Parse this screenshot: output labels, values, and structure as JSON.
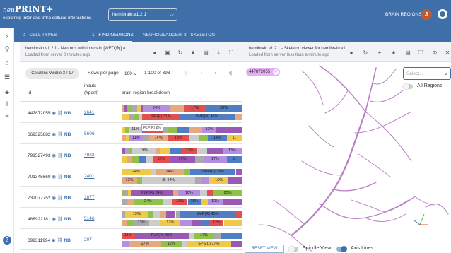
{
  "app": {
    "brand_prefix": "neu",
    "brand_main": "PRINT+",
    "subtitle": "exploring inter and intra cellular interactions",
    "dataset": "hemibrain:v1.2.1",
    "brain_regions_link": "BRAIN REGIONS",
    "user_initial": "J"
  },
  "sidebar": {
    "items": [
      {
        "icon": "chevron-right-icon",
        "glyph": "›"
      },
      {
        "icon": "search-icon",
        "glyph": "⚲"
      },
      {
        "icon": "home-icon",
        "glyph": "⌂"
      },
      {
        "icon": "list-icon",
        "glyph": "☰"
      },
      {
        "icon": "star-icon",
        "glyph": "★"
      },
      {
        "icon": "info-icon",
        "glyph": "i"
      },
      {
        "icon": "menu-icon",
        "glyph": "≡"
      }
    ],
    "help": "?"
  },
  "tabs": [
    "0 - CELL TYPES",
    "1 - FIND NEURONS",
    "NEUROGLANCER",
    "3 - SKELETON"
  ],
  "left_panel": {
    "title": "hemibrain:v1.2.1 - Neurons with inputs in [WED(R)] a...",
    "subtitle": "Loaded from server 3 minutes ago"
  },
  "right_panel": {
    "title": "hemibrain:v1.2.1 - Skeleton viewer for hemibrain:v1 ...",
    "subtitle": "Loaded from server less than a minute ago"
  },
  "pagination": {
    "columns_visible": "Columns Visible 3 / 17",
    "rows_per_page_label": "Rows per page:",
    "rows_per_page": "100",
    "range": "1-100 of 398"
  },
  "table": {
    "headers": {
      "id": "id",
      "inputs": "inputs",
      "inputs_sub": "(#post)",
      "breakdown": "brain region breakdown"
    },
    "rows": [
      {
        "id": "447872055",
        "nb": "NB",
        "inputs": "2641",
        "bar1": [
          [
            "#e6a97e",
            2
          ],
          [
            "#9b59b6",
            2
          ],
          [
            "#8fc14b",
            5
          ],
          [
            "#aaa",
            4
          ],
          [
            "#f0c84a",
            3
          ],
          [
            "#9b59b6",
            2
          ],
          [
            "#b48ee0",
            22
          ],
          [
            "#e6a97e",
            12
          ],
          [
            "#e34e4e",
            18
          ],
          [
            "#4f7ec4",
            30
          ]
        ],
        "labels1": {
          "6": "24%",
          "8": "17%",
          "9": "28%"
        },
        "bar2": [
          [
            "#f0c84a",
            6
          ],
          [
            "#aaa",
            4
          ],
          [
            "#8fc14b",
            4
          ],
          [
            "#ccc",
            3
          ],
          [
            "#e34e4e",
            31
          ],
          [
            "#4f7ec4",
            46
          ],
          [
            "#e6a97e",
            6
          ]
        ],
        "labels2": {
          "4": "SIP(R) 31%",
          "5": "SMP(R) 46%"
        }
      },
      {
        "id": "669325882",
        "nb": "NB",
        "inputs": "5606",
        "bar1": [
          [
            "#f0c84a",
            3
          ],
          [
            "#8fc14b",
            3
          ],
          [
            "#ccc",
            11
          ],
          [
            "#9b59b6",
            3
          ],
          [
            "#e34e4e",
            14
          ],
          [
            "#aaa",
            4
          ],
          [
            "#8fc14b",
            8
          ],
          [
            "#4f7ec4",
            10
          ],
          [
            "#e6a97e",
            11
          ],
          [
            "#b48ee0",
            12
          ],
          [
            "#9b59b6",
            21
          ]
        ],
        "labels1": {
          "2": "11%",
          "4": "14%",
          "9": "12%"
        },
        "bar2": [
          [
            "#e6a97e",
            3
          ],
          [
            "#f0c84a",
            2
          ],
          [
            "#b48ee0",
            11
          ],
          [
            "#aaa",
            4
          ],
          [
            "#e6a97e",
            14
          ],
          [
            "#e34e4e",
            15
          ],
          [
            "#ccc",
            8
          ],
          [
            "#8fc14b",
            6
          ],
          [
            "#4f7ec4",
            14
          ],
          [
            "#f0c84a",
            11
          ]
        ],
        "labels2": {
          "2": "11%",
          "4": "14%",
          "5": "15%",
          "8": "14%",
          "9": "11"
        }
      },
      {
        "id": "791527493",
        "nb": "NB",
        "inputs": "4922",
        "bar1": [
          [
            "#9b59b6",
            3
          ],
          [
            "#aaa",
            3
          ],
          [
            "#8fc14b",
            3
          ],
          [
            "#ccc",
            19
          ],
          [
            "#e6a97e",
            4
          ],
          [
            "#f0c84a",
            8
          ],
          [
            "#4f7ec4",
            10
          ],
          [
            "#e34e4e",
            13
          ],
          [
            "#ccc",
            8
          ],
          [
            "#9b59b6",
            13
          ],
          [
            "#b48ee0",
            16
          ]
        ],
        "labels1": {
          "3": "19%",
          "7": "13%",
          "10": "13%"
        },
        "bar2": [
          [
            "#f0c84a",
            4
          ],
          [
            "#e6a97e",
            4
          ],
          [
            "#8fc14b",
            5
          ],
          [
            "#4f7ec4",
            5
          ],
          [
            "#ccc",
            5
          ],
          [
            "#e34e4e",
            12
          ],
          [
            "#9b59b6",
            19
          ],
          [
            "#aaa",
            6
          ],
          [
            "#b48ee0",
            17
          ],
          [
            "#4f7ec4",
            11
          ]
        ],
        "labels2": {
          "5": "12%",
          "6": "19%",
          "8": "17%",
          "9": "11"
        }
      },
      {
        "id": "701345660",
        "nb": "NB",
        "inputs": "2401",
        "bar1": [
          [
            "#f0c84a",
            24
          ],
          [
            "#ccc",
            4
          ],
          [
            "#e6a97e",
            24
          ],
          [
            "#8fc14b",
            5
          ],
          [
            "#4f7ec4",
            38
          ],
          [
            "#9b59b6",
            5
          ]
        ],
        "labels1": {
          "0": "24%",
          "2": "24%",
          "4": "SMP(R) 38%"
        },
        "bar2": [
          [
            "#e6a97e",
            13
          ],
          [
            "#8fc14b",
            4
          ],
          [
            "#ccc",
            44
          ],
          [
            "#aaa",
            6
          ],
          [
            "#b48ee0",
            6
          ],
          [
            "#f0c84a",
            16
          ],
          [
            "#9b59b6",
            11
          ]
        ],
        "labels2": {
          "0": "13%",
          "2": "IB 44%",
          "5": "16%"
        }
      },
      {
        "id": "732077752",
        "nb": "NB",
        "inputs": "2877",
        "bar1": [
          [
            "#8fc14b",
            2
          ],
          [
            "#aaa",
            3
          ],
          [
            "#f0c84a",
            3
          ],
          [
            "#9b59b6",
            34
          ],
          [
            "#e6a97e",
            4
          ],
          [
            "#b48ee0",
            18
          ],
          [
            "#ccc",
            6
          ],
          [
            "#e34e4e",
            5
          ],
          [
            "#8fc14b",
            23
          ]
        ],
        "labels1": {
          "3": "PLP(R) 34%",
          "5": "18%",
          "8": "23%"
        },
        "bar2": [
          [
            "#aaa",
            4
          ],
          [
            "#e6a97e",
            6
          ],
          [
            "#8fc14b",
            24
          ],
          [
            "#ccc",
            8
          ],
          [
            "#e34e4e",
            13
          ],
          [
            "#4f7ec4",
            11
          ],
          [
            "#f0c84a",
            6
          ],
          [
            "#b48ee0",
            12
          ],
          [
            "#9b59b6",
            16
          ]
        ],
        "labels2": {
          "2": "24%",
          "4": "13%",
          "5": "11%",
          "7": "12%"
        }
      },
      {
        "id": "488922181",
        "nb": "NB",
        "inputs": "5146",
        "bar1": [
          [
            "#aaa",
            3
          ],
          [
            "#f0c84a",
            19
          ],
          [
            "#8fc14b",
            4
          ],
          [
            "#ccc",
            6
          ],
          [
            "#e6a97e",
            5
          ],
          [
            "#9b59b6",
            8
          ],
          [
            "#aaa",
            4
          ],
          [
            "#4f7ec4",
            45
          ],
          [
            "#e34e4e",
            6
          ]
        ],
        "labels1": {
          "1": "19%",
          "7": "SMP(R) 45%"
        },
        "bar2": [
          [
            "#e6a97e",
            4
          ],
          [
            "#8fc14b",
            6
          ],
          [
            "#aaa",
            13
          ],
          [
            "#ccc",
            9
          ],
          [
            "#f0c84a",
            17
          ],
          [
            "#b48ee0",
            10
          ],
          [
            "#9b59b6",
            8
          ],
          [
            "#4f7ec4",
            6
          ],
          [
            "#e34e4e",
            12
          ],
          [
            "#f0c84a",
            15
          ]
        ],
        "labels2": {
          "2": "13%",
          "4": "17%",
          "8": "12%"
        }
      },
      {
        "id": "699311994",
        "nb": "NB",
        "inputs": "207",
        "bar1": [
          [
            "#e34e4e",
            11
          ],
          [
            "#9b59b6",
            45
          ],
          [
            "#ccc",
            4
          ],
          [
            "#8fc14b",
            17
          ],
          [
            "#aaa",
            6
          ],
          [
            "#4f7ec4",
            17
          ]
        ],
        "labels1": {
          "0": "11%",
          "1": "PLP(R) 45%",
          "3": "17%"
        },
        "bar2": [
          [
            "#b48ee0",
            6
          ],
          [
            "#e6a97e",
            27
          ],
          [
            "#8fc14b",
            17
          ],
          [
            "#ccc",
            4
          ],
          [
            "#f0c84a",
            37
          ],
          [
            "#9b59b6",
            9
          ]
        ],
        "labels2": {
          "1": "27%",
          "2": "17%",
          "4": "SPS(L) 37%"
        }
      }
    ],
    "tooltip": "PLP(R) 8%"
  },
  "viewer": {
    "chip": "447872055",
    "select_placeholder": "Select...",
    "all_regions": "All Regions",
    "reset": "RESET VIEW",
    "spindle": "Spindle View",
    "axis": "Axis Lines",
    "neuron_color": "#b77fc4"
  }
}
